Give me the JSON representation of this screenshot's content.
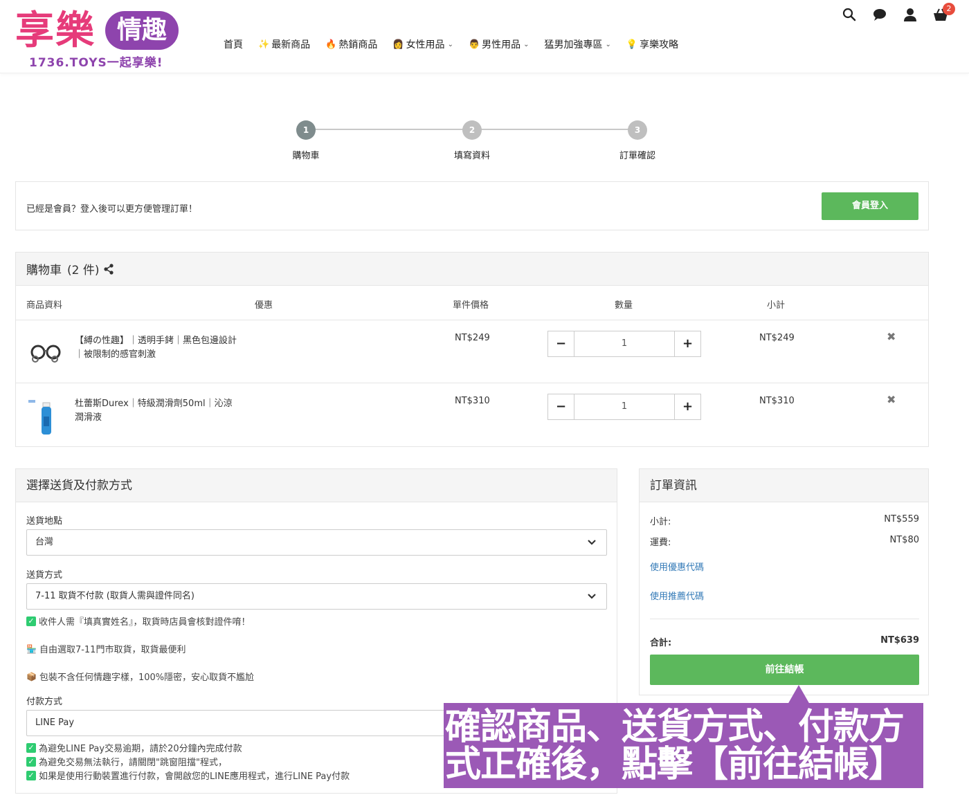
{
  "logo": {
    "main_text": "享樂",
    "badge_text": "情趣",
    "sub_text": "1736.TOYS一起享樂!"
  },
  "nav": [
    {
      "label": "首頁",
      "emoji": "",
      "dropdown": false
    },
    {
      "label": "最新商品",
      "emoji": "✨",
      "dropdown": false
    },
    {
      "label": "熱銷商品",
      "emoji": "🔥",
      "dropdown": false
    },
    {
      "label": "女性用品",
      "emoji": "👩",
      "dropdown": true
    },
    {
      "label": "男性用品",
      "emoji": "👨",
      "dropdown": true
    },
    {
      "label": "猛男加強專區",
      "emoji": "",
      "dropdown": true
    },
    {
      "label": "享樂攻略",
      "emoji": "💡",
      "dropdown": false
    }
  ],
  "top_icons": {
    "search": "search-icon",
    "chat": "chat-icon",
    "user": "user-icon",
    "cart": "cart-icon",
    "cart_count": "2"
  },
  "steps": [
    {
      "number": "1",
      "label": "購物車",
      "active": true
    },
    {
      "number": "2",
      "label": "填寫資料",
      "active": false
    },
    {
      "number": "3",
      "label": "訂單確認",
      "active": false
    }
  ],
  "member": {
    "text": "已經是會員？登入後可以更方便管理訂單！",
    "button": "會員登入"
  },
  "cart": {
    "title": "購物車",
    "count_text": "(2 件)",
    "columns": [
      "商品資料",
      "優惠",
      "單件價格",
      "數量",
      "小計"
    ],
    "items": [
      {
        "name": "【縛の性趣】｜透明手銬｜黑色包邊設計｜被限制的感官刺激",
        "price": "NT$249",
        "qty": "1",
        "subtotal": "NT$249"
      },
      {
        "name": "杜蕾斯Durex｜特級潤滑劑50ml｜沁涼潤滑液",
        "price": "NT$310",
        "qty": "1",
        "subtotal": "NT$310"
      }
    ]
  },
  "shipping": {
    "title": "選擇送貨及付款方式",
    "location_label": "送貨地點",
    "location_value": "台灣",
    "method_label": "送貨方式",
    "method_value": "7-11 取貨不付款 (取貨人需與證件同名)",
    "notes": [
      "收件人需『填真實姓名』，取貨時店員會核對證件唷！",
      "自由選取7-11門市取貨，取貨最便利",
      "包裝不含任何情趣字樣，100%隱密，安心取貨不尷尬"
    ],
    "payment_label": "付款方式",
    "payment_value": "LINE Pay",
    "payment_notes": [
      "為避免LINE Pay交易逾期，請於20分鐘內完成付款",
      "為避免交易無法執行，請關閉\"跳窗阻擋\"程式，",
      "如果是使用行動裝置進行付款，會開啟您的LINE應用程式，進行LINE Pay付款"
    ]
  },
  "order": {
    "title": "訂單資訊",
    "subtotal_label": "小計:",
    "subtotal_value": "NT$559",
    "shipping_label": "運費:",
    "shipping_value": "NT$80",
    "coupon_link": "使用優惠代碼",
    "referral_link": "使用推薦代碼",
    "total_label": "合計:",
    "total_value": "NT$639",
    "checkout_button": "前往結帳"
  },
  "callout": {
    "text": "確認商品、送貨方式、付款方式正確後，點擊【前往結帳】"
  },
  "colors": {
    "green": "#5cb85c",
    "purple": "#9b59b6",
    "pink": "#e63b7a",
    "link": "#337ab7"
  }
}
